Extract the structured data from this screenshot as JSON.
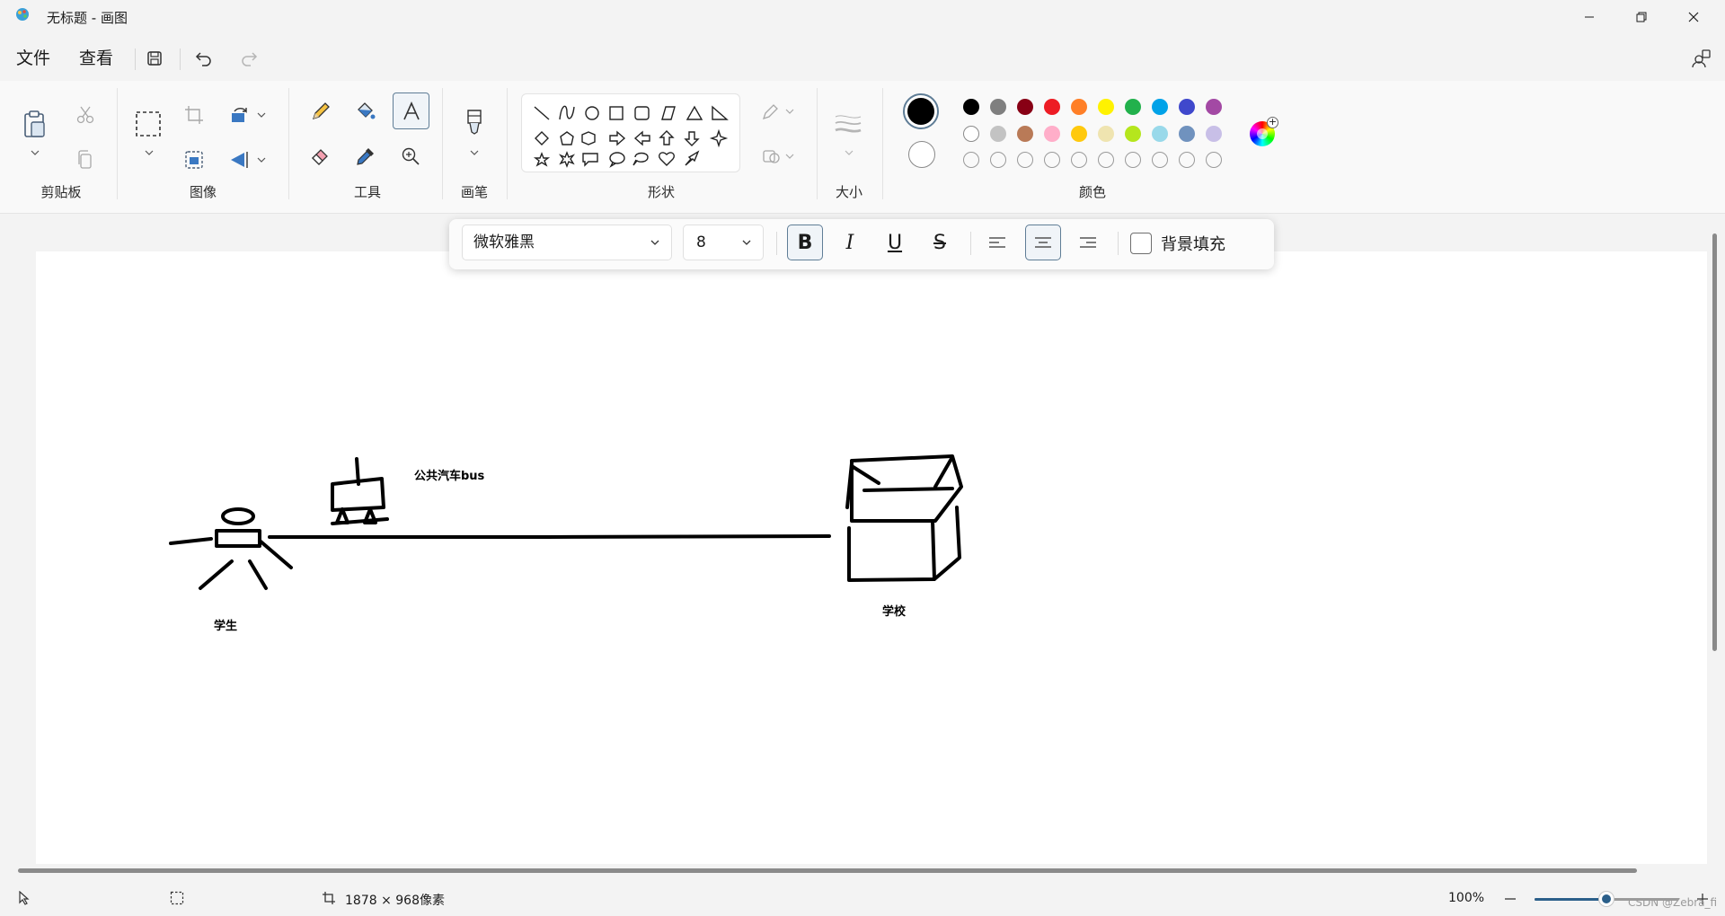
{
  "window": {
    "title": "无标题 - 画图"
  },
  "menu": {
    "file": "文件",
    "view": "查看"
  },
  "ribbon": {
    "groups": {
      "clipboard": "剪贴板",
      "image": "图像",
      "tools": "工具",
      "brushes": "画笔",
      "shapes": "形状",
      "size": "大小",
      "colors": "颜色"
    },
    "colors": {
      "primary": "#000000",
      "secondary": "#ffffff",
      "row1": [
        "#000000",
        "#7f7f7f",
        "#880015",
        "#ed1c24",
        "#ff7f27",
        "#fff200",
        "#22b14c",
        "#00a2e8",
        "#3f48cc",
        "#a349a4"
      ],
      "row2": [
        "#ffffff",
        "#c3c3c3",
        "#b97a57",
        "#ffaec9",
        "#ffc90e",
        "#efe4b0",
        "#b5e61d",
        "#99d9ea",
        "#7092be",
        "#c8bfe7"
      ]
    }
  },
  "text_toolbar": {
    "font": "微软雅黑",
    "size": "8",
    "bold": "B",
    "italic": "I",
    "underline": "U",
    "strike": "S",
    "background_fill": "背景填充"
  },
  "canvas": {
    "labels": {
      "bus": "公共汽车bus",
      "student": "学生",
      "school": "学校"
    }
  },
  "status": {
    "dimensions": "1878 × 968像素",
    "zoom": "100%",
    "zoom_level": 0.5,
    "watermark": "CSDN @Zebra_fi"
  }
}
